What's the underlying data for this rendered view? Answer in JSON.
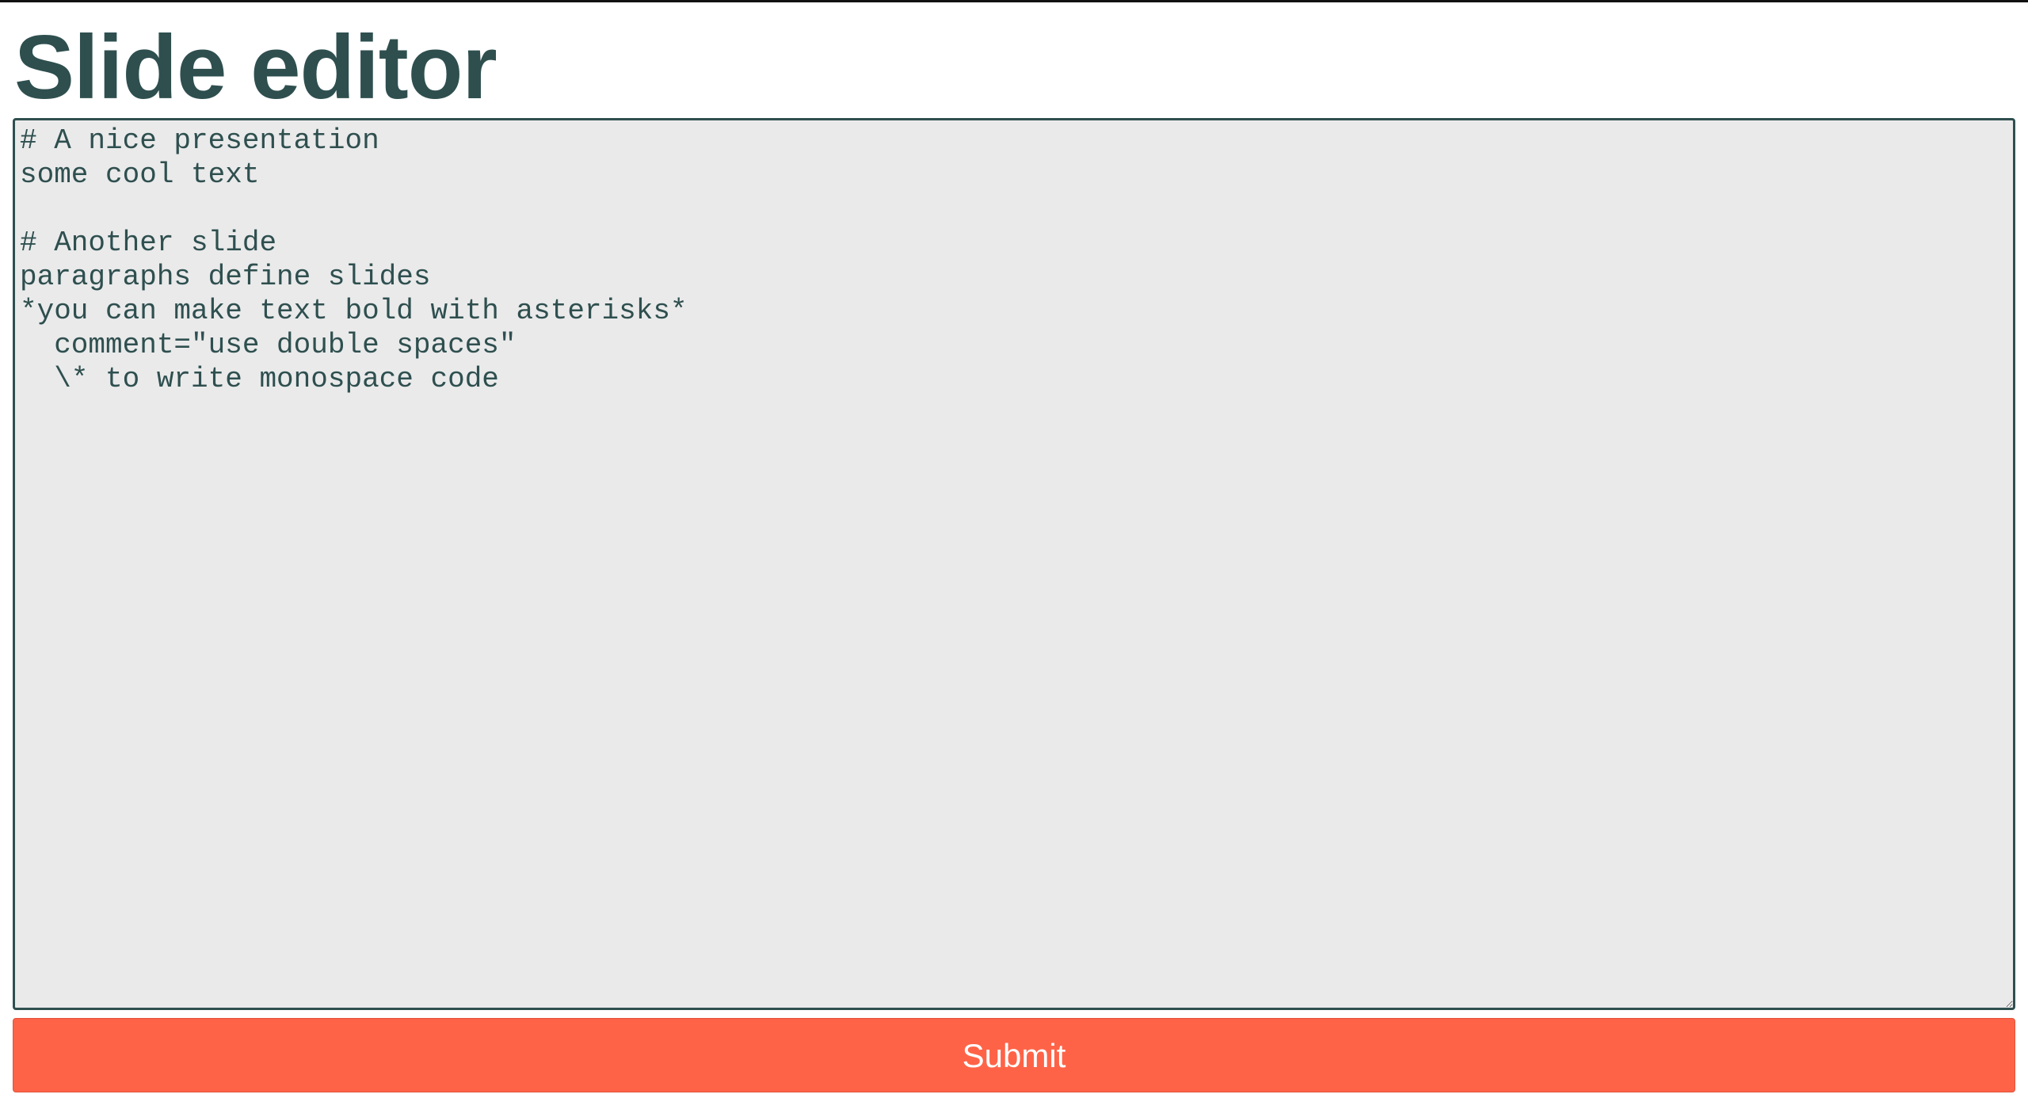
{
  "page": {
    "title": "Slide editor"
  },
  "editor": {
    "value": "# A nice presentation\nsome cool text\n\n# Another slide\nparagraphs define slides\n*you can make text bold with asterisks*\n  comment=\"use double spaces\"\n  \\* to write monospace code"
  },
  "form": {
    "submit_label": "Submit"
  },
  "colors": {
    "text": "#2f4f4f",
    "editor_background": "#eaeaea",
    "submit_background": "#ff6347",
    "submit_text": "#ffffff"
  }
}
